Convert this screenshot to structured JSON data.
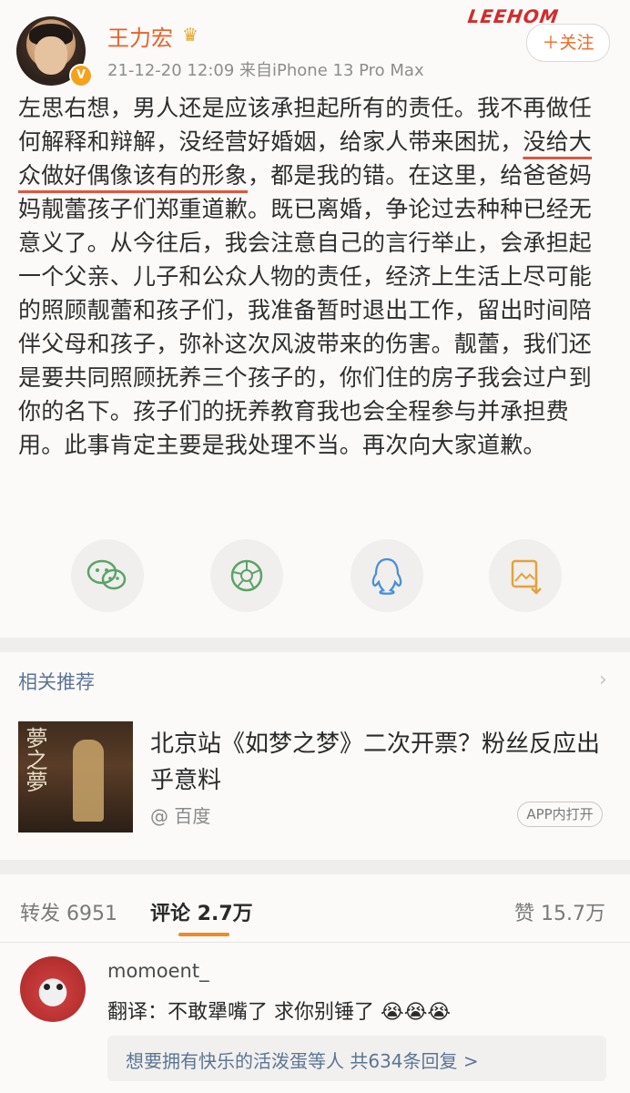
{
  "header": {
    "username": "王力宏",
    "crown_icon": "crown-icon",
    "verified_badge": "V",
    "meta": "21-12-20 12:09 来自iPhone 13 Pro Max",
    "brand": "LEEHOM",
    "follow_label": "＋关注"
  },
  "post": {
    "part1": "左思右想，男人还是应该承担起所有的责任。我不再做任何解释和辩解，没经营好婚姻，给家人带来困扰，",
    "highlight": "没给大众做好偶像该有的形象",
    "part2": "，都是我的错。在这里，给爸爸妈妈靓蕾孩子们郑重道歉。既已离婚，争论过去种种已经无意义了。从今往后，我会注意自己的言行举止，会承担起一个父亲、儿子和公众人物的责任，经济上生活上尽可能的照顾靓蕾和孩子们，我准备暂时退出工作，留出时间陪伴父母和孩子，弥补这次风波带来的伤害。靓蕾，我们还是要共同照顾抚养三个孩子的，你们住的房子我会过户到你的名下。孩子们的抚养教育我也会全程参与并承担费用。此事肯定主要是我处理不当。再次向大家道歉。"
  },
  "share": {
    "wechat": "wechat-icon",
    "moments": "moments-icon",
    "qq": "qq-icon",
    "save_image": "save-image-icon"
  },
  "related": {
    "title": "相关推荐",
    "thumb_text": "夢之夢",
    "headline": "北京站《如梦之梦》二次开票？粉丝反应出乎意料",
    "source": "@ 百度",
    "app_button": "APP内打开"
  },
  "tabs": {
    "repost": "转发 6951",
    "comment": "评论 2.7万",
    "like": "赞 15.7万"
  },
  "comment": {
    "username": "momoent_",
    "text": "翻译：不敢犟嘴了 求你别锤了 😭😭😭",
    "reply_summary": "想要拥有快乐的活泼蛋等人  共634条回复 >"
  },
  "colors": {
    "accent": "#ef6a24",
    "username": "#e6632a",
    "link_blue": "#5c7594",
    "underline_red": "#e0553e"
  }
}
